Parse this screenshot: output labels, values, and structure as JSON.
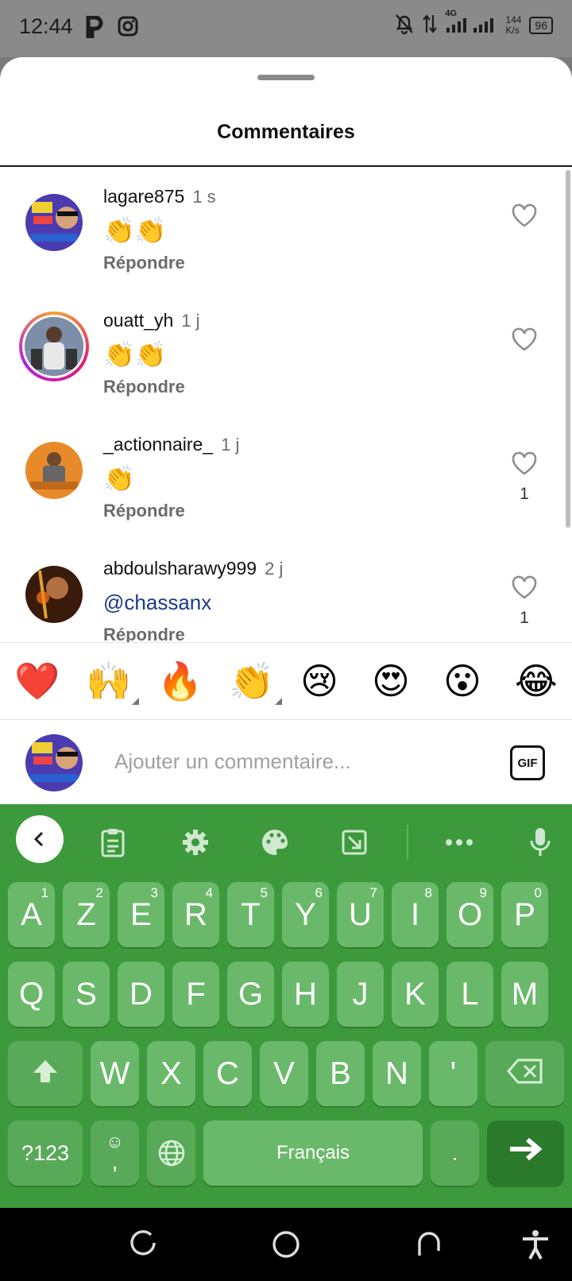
{
  "status_bar": {
    "time": "12:44",
    "network": "4G",
    "speed_value": "144",
    "speed_unit": "K/s",
    "battery": "96"
  },
  "sheet": {
    "title": "Commentaires"
  },
  "comments": [
    {
      "username": "lagare875",
      "time": "1 s",
      "text": "👏👏",
      "reply_label": "Répondre",
      "likes": ""
    },
    {
      "username": "ouatt_yh",
      "time": "1 j",
      "text": "👏👏",
      "reply_label": "Répondre",
      "likes": ""
    },
    {
      "username": "_actionnaire_",
      "time": "1 j",
      "text": "👏",
      "reply_label": "Répondre",
      "likes": "1"
    },
    {
      "username": "abdoulsharawy999",
      "time": "2 j",
      "text": "@chassanx",
      "reply_label": "Répondre",
      "likes": "1"
    }
  ],
  "emoji_bar": [
    "❤️",
    "🙌",
    "🔥",
    "👏",
    "😢",
    "😍",
    "😮",
    "😂"
  ],
  "compose": {
    "placeholder": "Ajouter un commentaire...",
    "gif_label": "GIF"
  },
  "keyboard": {
    "row1": [
      {
        "key": "A",
        "hint": "1"
      },
      {
        "key": "Z",
        "hint": "2"
      },
      {
        "key": "E",
        "hint": "3"
      },
      {
        "key": "R",
        "hint": "4"
      },
      {
        "key": "T",
        "hint": "5"
      },
      {
        "key": "Y",
        "hint": "6"
      },
      {
        "key": "U",
        "hint": "7"
      },
      {
        "key": "I",
        "hint": "8"
      },
      {
        "key": "O",
        "hint": "9"
      },
      {
        "key": "P",
        "hint": "0"
      }
    ],
    "row2": [
      "Q",
      "S",
      "D",
      "F",
      "G",
      "H",
      "J",
      "K",
      "L",
      "M"
    ],
    "row3": [
      "W",
      "X",
      "C",
      "V",
      "B",
      "N",
      "'"
    ],
    "symbols_label": "?123",
    "comma_label": ",",
    "space_label": "Français",
    "period_label": "."
  },
  "colors": {
    "keyboard_bg": "#3c9a3c",
    "key_bg": "#6ab96a",
    "mention": "#1b3a8a"
  }
}
